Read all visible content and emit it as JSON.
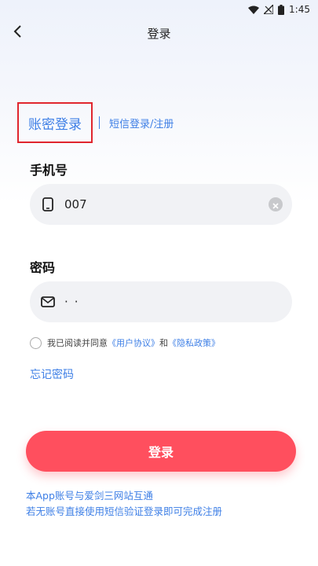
{
  "status_bar": {
    "time": "1:45"
  },
  "header": {
    "title": "登录"
  },
  "tabs": {
    "active": "账密登录",
    "inactive": "短信登录/注册"
  },
  "phone": {
    "label": "手机号",
    "value": "007"
  },
  "password": {
    "label": "密码",
    "value": "··"
  },
  "agreement": {
    "prefix": "我已阅读并同意",
    "user_agreement": "《用户协议》",
    "and": "和",
    "privacy_policy": "《隐私政策》"
  },
  "forgot_password": "忘记密码",
  "login_button": "登录",
  "notes": {
    "line1": "本App账号与爱剑三网站互通",
    "line2": "若无账号直接使用短信验证登录即可完成注册"
  },
  "colors": {
    "accent": "#3e7fe6",
    "button": "#ff4f5e",
    "highlight_border": "#e0262e"
  },
  "icons": [
    "wifi-icon",
    "signal-icon",
    "battery-icon",
    "back-arrow-icon",
    "phone-icon",
    "mail-icon",
    "clear-icon"
  ]
}
